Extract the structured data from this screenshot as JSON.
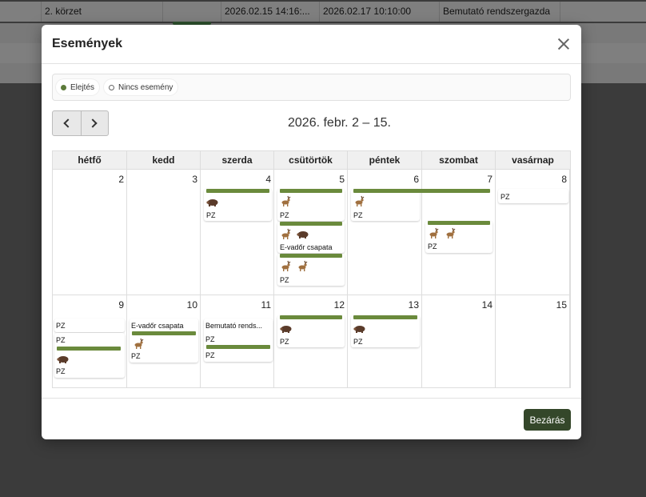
{
  "background": {
    "row1": [
      "2. körzet",
      "",
      "2026.02.15 14:16:...",
      "2026.02.17 10:10:00",
      "Bemutató rendszergazda"
    ]
  },
  "modal": {
    "title": "Események",
    "close_label": "Bezárás",
    "legend": [
      {
        "label": "Elejtés",
        "marker": "filled-dot"
      },
      {
        "label": "Nincs esemény",
        "marker": "empty-dot"
      }
    ],
    "range": "2026. febr. 2 – 15."
  },
  "calendar": {
    "weekdays": [
      "hétfő",
      "kedd",
      "szerda",
      "csütörtök",
      "péntek",
      "szombat",
      "vasárnap"
    ],
    "week1": [
      "2",
      "3",
      "4",
      "5",
      "6",
      "7",
      "8"
    ],
    "week2": [
      "9",
      "10",
      "11",
      "12",
      "13",
      "14",
      "15"
    ],
    "events": {
      "pz": "PZ",
      "evadasz": "E-vadőr csapata",
      "bemutato": "Bemutató rends..."
    }
  },
  "colors": {
    "accent": "#6a8a3c",
    "button": "#34472a"
  }
}
